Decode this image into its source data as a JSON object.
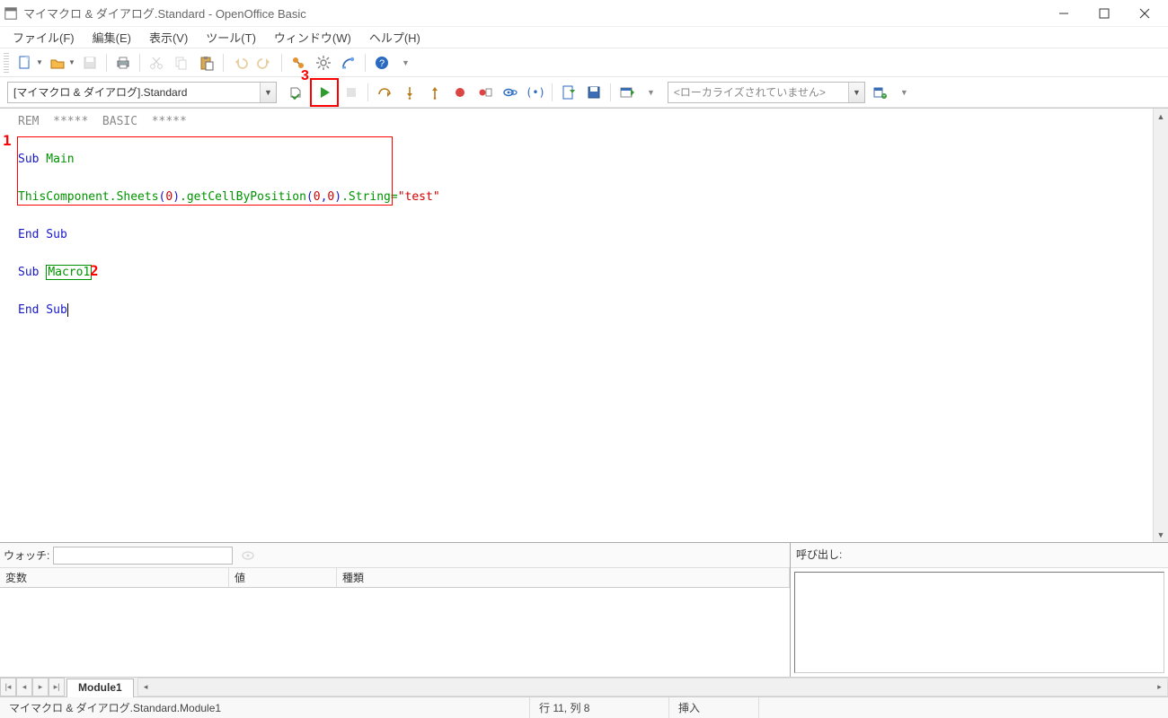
{
  "window": {
    "title": "マイマクロ & ダイアログ.Standard - OpenOffice Basic"
  },
  "menu": {
    "file": "ファイル(F)",
    "edit": "編集(E)",
    "view": "表示(V)",
    "tools": "ツール(T)",
    "window": "ウィンドウ(W)",
    "help": "ヘルプ(H)"
  },
  "library_select": "[マイマクロ & ダイアログ].Standard",
  "locale_select": "<ローカライズされていません>",
  "annotations": {
    "one": "1",
    "two": "2",
    "three": "3"
  },
  "code": {
    "l1_rem": "REM  *****  BASIC  *****",
    "l3_sub": "Sub",
    "l3_main": " Main",
    "l5_thiscomp": "ThisComponent.Sheets",
    "l5_lp1": "(",
    "l5_zero1": "0",
    "l5_rp1": ")",
    "l5_getcell": ".getCellByPosition",
    "l5_lp2": "(",
    "l5_zero2": "0",
    "l5_comma": ",",
    "l5_zero3": "0",
    "l5_rp2": ")",
    "l5_string": ".String=",
    "l5_q1": "\"",
    "l5_test": "test",
    "l5_q2": "\"",
    "l7_endsub": "End Sub",
    "l9_sub": "Sub",
    "l9_sp": " ",
    "l9_macro1": "Macro1",
    "l11_endsub": "End Sub"
  },
  "watch": {
    "label": "ウォッチ:",
    "col_var": "変数",
    "col_val": "値",
    "col_type": "種類"
  },
  "call_stack": {
    "label": "呼び出し:"
  },
  "module_tab": "Module1",
  "status": {
    "path": "マイマクロ & ダイアログ.Standard.Module1",
    "pos": "行 11, 列 8",
    "mode": "挿入"
  }
}
